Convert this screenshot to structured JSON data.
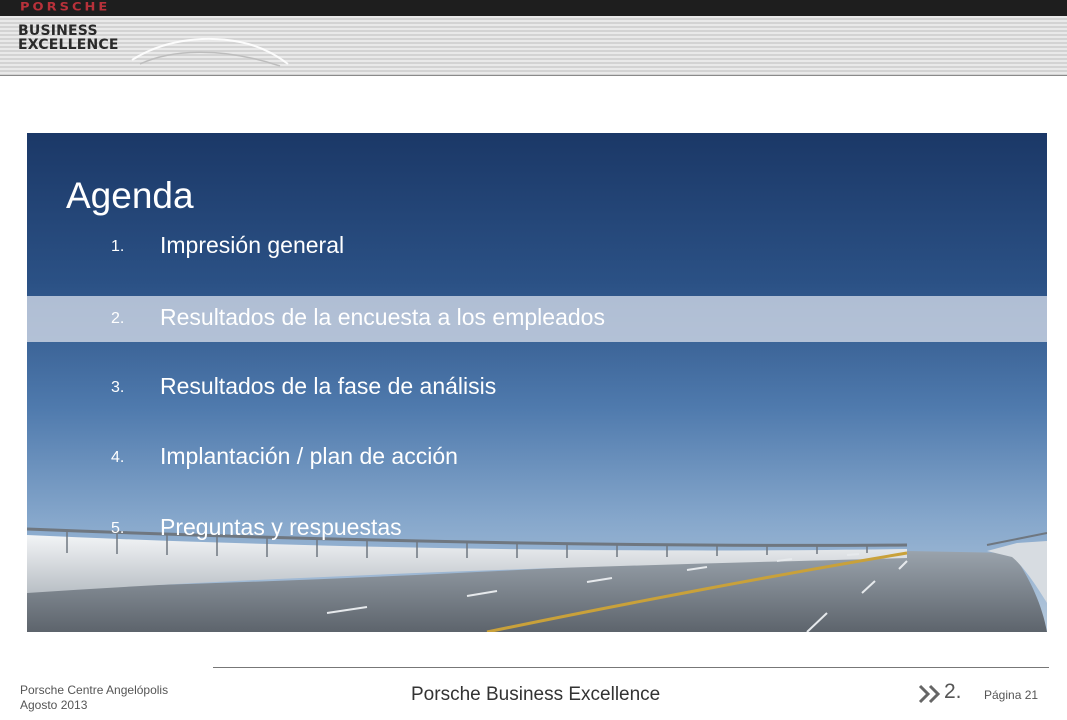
{
  "header": {
    "brand": "PORSCHE",
    "title_line1": "BUSINESS",
    "title_line2": "EXCELLENCE"
  },
  "agenda": {
    "title": "Agenda",
    "items": [
      {
        "number": "1.",
        "label": "Impresión general",
        "active": false
      },
      {
        "number": "2.",
        "label": "Resultados de la encuesta a los empleados",
        "active": true
      },
      {
        "number": "3.",
        "label": "Resultados de la fase de análisis",
        "active": false
      },
      {
        "number": "4.",
        "label": "Implantación / plan de acción",
        "active": false
      },
      {
        "number": "5.",
        "label": "Preguntas y respuestas",
        "active": false
      }
    ]
  },
  "footer": {
    "company": "Porsche Centre  Angelópolis",
    "date": "Agosto 2013",
    "center_title": "Porsche Business Excellence",
    "section": "2.",
    "page_label": "Página 21"
  },
  "colors": {
    "brand_red": "#b8313a",
    "sky_top": "#1b3867",
    "highlight": "#cdd6e4"
  }
}
